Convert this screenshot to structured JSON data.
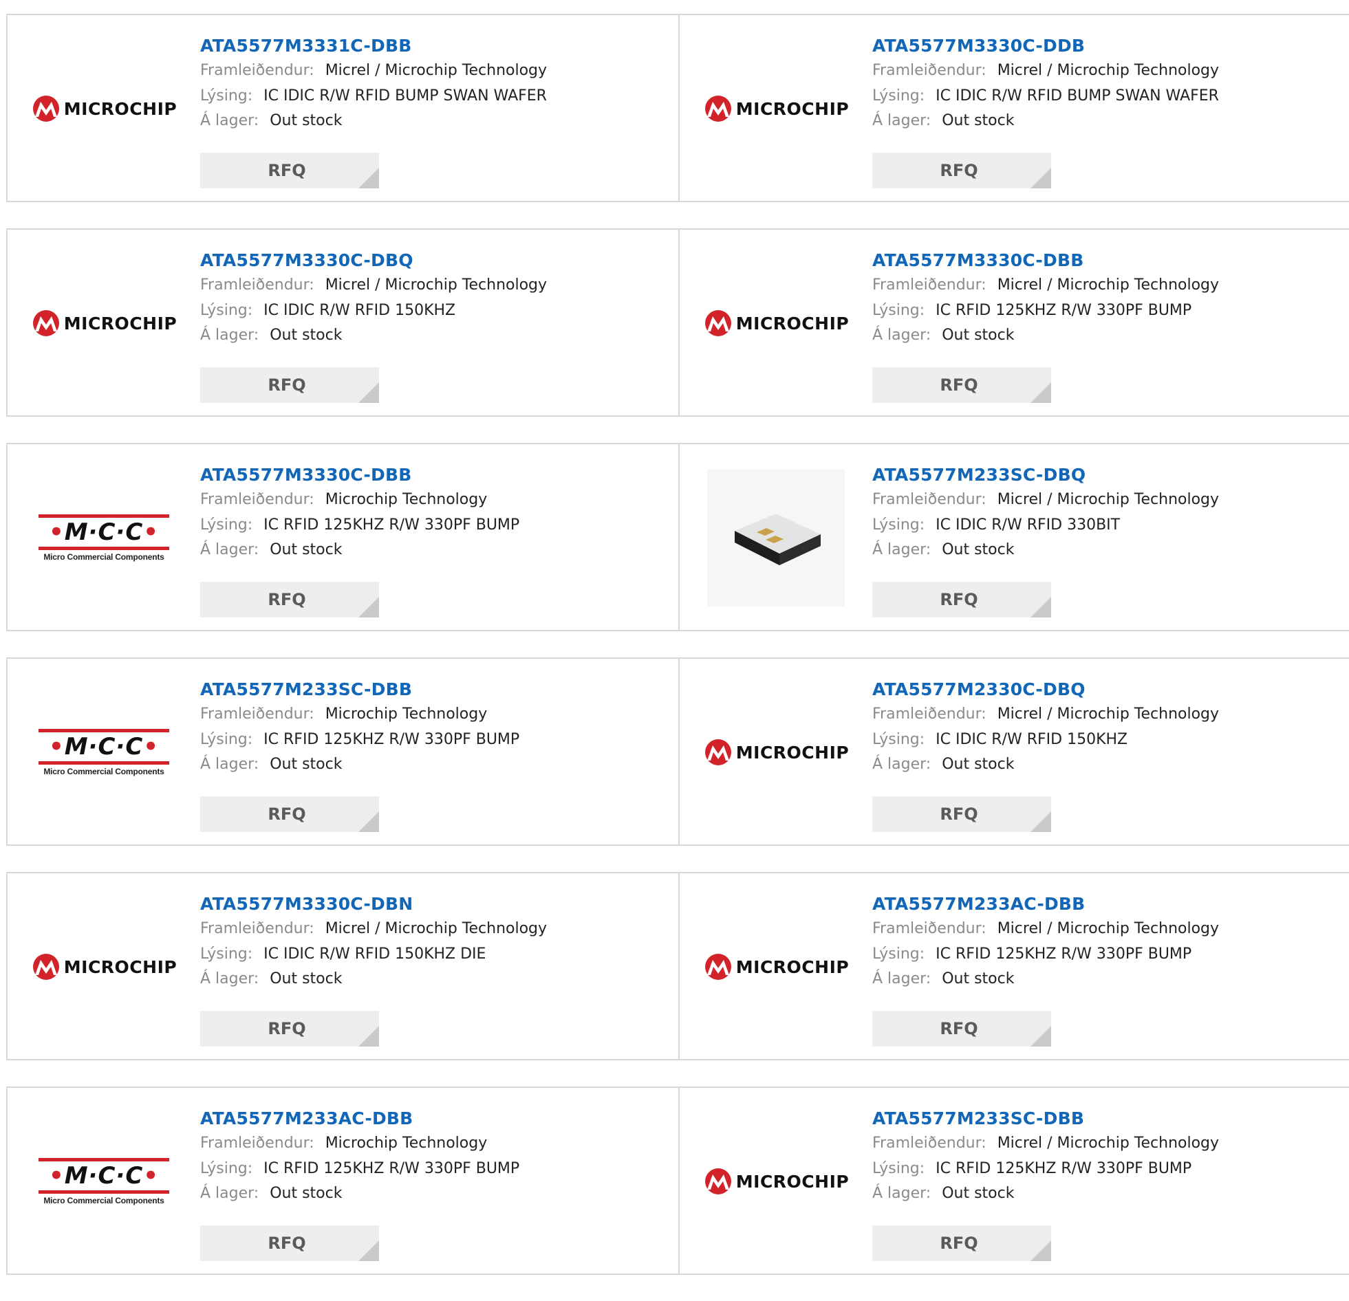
{
  "labels": {
    "manufacturer": "Framleiðendur:",
    "description": "Lýsing:",
    "stock": "Á lager:",
    "rfq": "RFQ"
  },
  "logos": {
    "microchip": "MICROCHIP",
    "mcc_letters": "M·C·C",
    "mcc_sub": "Micro Commercial Components"
  },
  "colors": {
    "part_link": "#1166b8",
    "brand_red": "#d2222a",
    "label_gray": "#8a8a8a"
  },
  "rows": [
    {
      "left": {
        "logo": "microchip",
        "part": "ATA5577M3331C-DBB",
        "manufacturer": "Micrel / Microchip Technology",
        "description": "IC IDIC R/W RFID BUMP SWAN WAFER",
        "stock": "Out stock"
      },
      "right": {
        "logo": "microchip",
        "part": "ATA5577M3330C-DDB",
        "manufacturer": "Micrel / Microchip Technology",
        "description": "IC IDIC R/W RFID BUMP SWAN WAFER",
        "stock": "Out stock"
      }
    },
    {
      "left": {
        "logo": "microchip",
        "part": "ATA5577M3330C-DBQ",
        "manufacturer": "Micrel / Microchip Technology",
        "description": "IC IDIC R/W RFID 150KHZ",
        "stock": "Out stock"
      },
      "right": {
        "logo": "microchip",
        "part": "ATA5577M3330C-DBB",
        "manufacturer": "Micrel / Microchip Technology",
        "description": "IC RFID 125KHZ R/W 330PF BUMP",
        "stock": "Out stock"
      }
    },
    {
      "left": {
        "logo": "mcc",
        "part": "ATA5577M3330C-DBB",
        "manufacturer": "Microchip Technology",
        "description": "IC RFID 125KHZ R/W 330PF BUMP",
        "stock": "Out stock"
      },
      "right": {
        "logo": "chip",
        "part": "ATA5577M233SC-DBQ",
        "manufacturer": "Micrel / Microchip Technology",
        "description": "IC IDIC R/W RFID 330BIT",
        "stock": "Out stock"
      }
    },
    {
      "left": {
        "logo": "mcc",
        "part": "ATA5577M233SC-DBB",
        "manufacturer": "Microchip Technology",
        "description": "IC RFID 125KHZ R/W 330PF BUMP",
        "stock": "Out stock"
      },
      "right": {
        "logo": "microchip",
        "part": "ATA5577M2330C-DBQ",
        "manufacturer": "Micrel / Microchip Technology",
        "description": "IC IDIC R/W RFID 150KHZ",
        "stock": "Out stock"
      }
    },
    {
      "left": {
        "logo": "microchip",
        "part": "ATA5577M3330C-DBN",
        "manufacturer": "Micrel / Microchip Technology",
        "description": "IC IDIC R/W RFID 150KHZ DIE",
        "stock": "Out stock"
      },
      "right": {
        "logo": "microchip",
        "part": "ATA5577M233AC-DBB",
        "manufacturer": "Micrel / Microchip Technology",
        "description": "IC RFID 125KHZ R/W 330PF BUMP",
        "stock": "Out stock"
      }
    },
    {
      "left": {
        "logo": "mcc",
        "part": "ATA5577M233AC-DBB",
        "manufacturer": "Microchip Technology",
        "description": "IC RFID 125KHZ R/W 330PF BUMP",
        "stock": "Out stock"
      },
      "right": {
        "logo": "microchip",
        "part": "ATA5577M233SC-DBB",
        "manufacturer": "Micrel / Microchip Technology",
        "description": "IC RFID 125KHZ R/W 330PF BUMP",
        "stock": "Out stock"
      }
    }
  ]
}
